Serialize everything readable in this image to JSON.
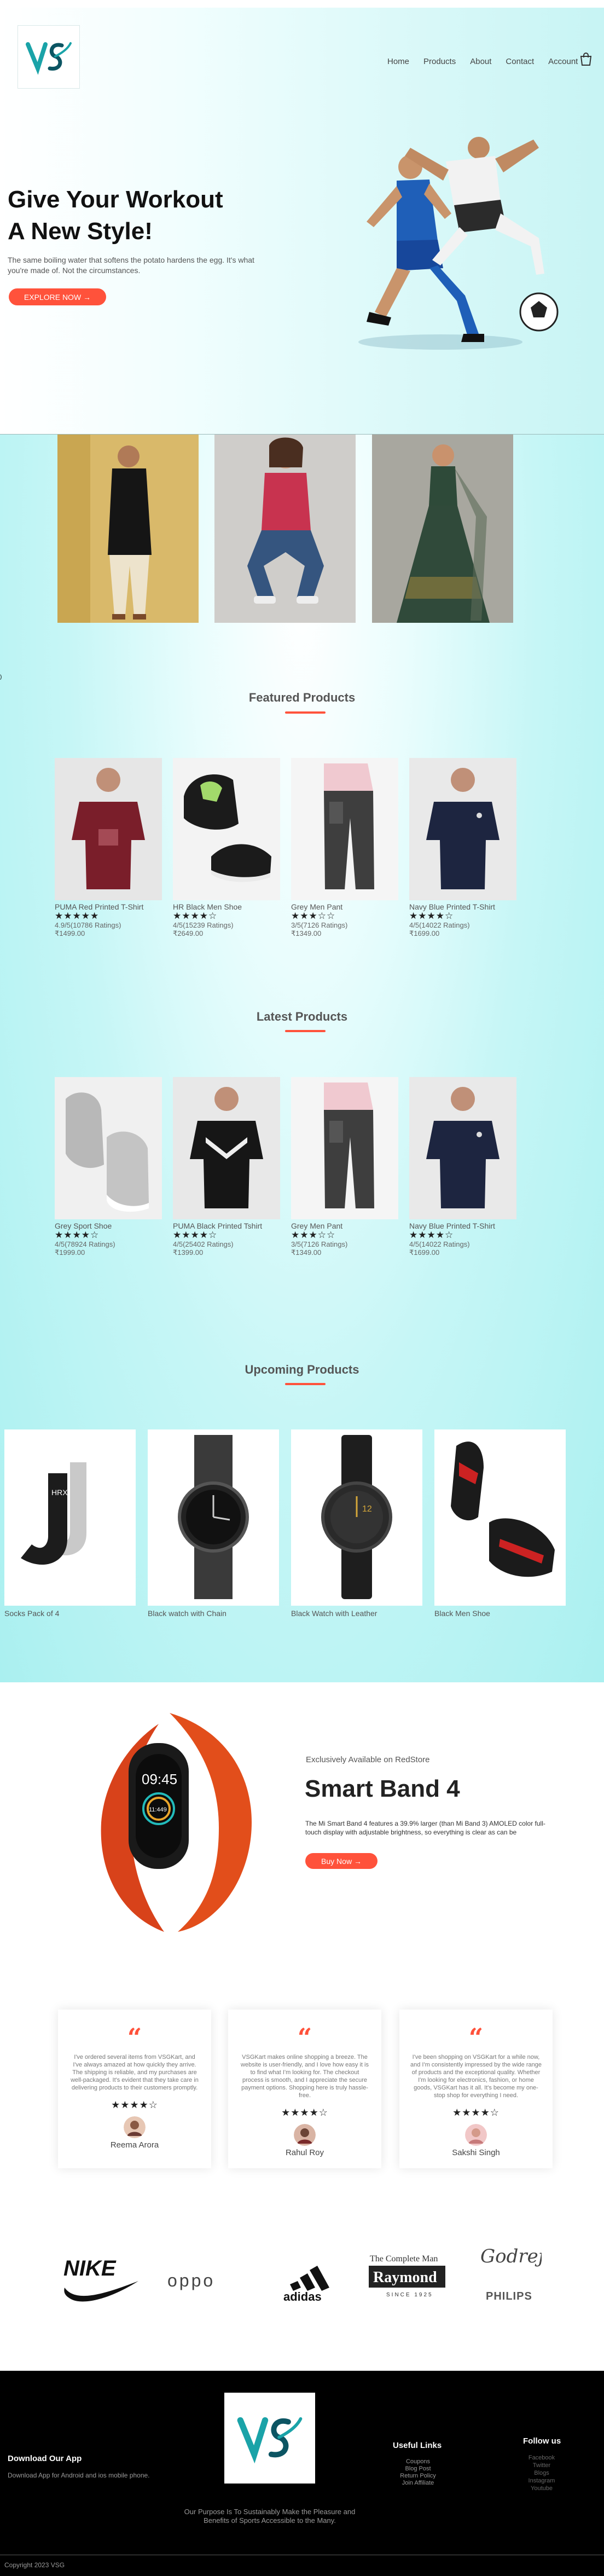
{
  "brand": {
    "logo_text": "VS"
  },
  "nav": {
    "items": [
      "Home",
      "Products",
      "About",
      "Contact",
      "Account"
    ]
  },
  "hero": {
    "title_line1": "Give Your Workout",
    "title_line2": "A New Style!",
    "subtitle": "The same boiling water that softens the potato hardens the egg. It's what you're made of. Not the circumstances.",
    "cta": "EXPLORE NOW →"
  },
  "featured": {
    "title": "Featured Products",
    "products": [
      {
        "name": "PUMA Red Printed T-Shirt",
        "stars": "★★★★★",
        "rating": "4.9/5(10786 Ratings)",
        "price": "₹1499.00"
      },
      {
        "name": "HR Black Men Shoe",
        "stars": "★★★★☆",
        "rating": "4/5(15239 Ratings)",
        "price": "₹2649.00"
      },
      {
        "name": "Grey Men Pant",
        "stars": "★★★☆☆",
        "rating": "3/5(7126 Ratings)",
        "price": "₹1349.00"
      },
      {
        "name": "Navy Blue Printed T-Shirt",
        "stars": "★★★★☆",
        "rating": "4/5(14022 Ratings)",
        "price": "₹1699.00"
      }
    ]
  },
  "latest": {
    "title": "Latest Products",
    "products": [
      {
        "name": "Grey Sport Shoe",
        "stars": "★★★★☆",
        "rating": "4/5(78924 Ratings)",
        "price": "₹1999.00"
      },
      {
        "name": "PUMA Black Printed Tshirt",
        "stars": "★★★★☆",
        "rating": "4/5(25402 Ratings)",
        "price": "₹1399.00"
      },
      {
        "name": "Grey Men Pant",
        "stars": "★★★☆☆",
        "rating": "3/5(7126 Ratings)",
        "price": "₹1349.00"
      },
      {
        "name": "Navy Blue Printed T-Shirt",
        "stars": "★★★★☆",
        "rating": "4/5(14022 Ratings)",
        "price": "₹1699.00"
      }
    ]
  },
  "upcoming": {
    "title": "Upcoming Products",
    "products": [
      {
        "name": "Socks Pack of 4"
      },
      {
        "name": "Black watch with Chain"
      },
      {
        "name": "Black Watch with Leather"
      },
      {
        "name": "Black Men Shoe"
      }
    ]
  },
  "smartband": {
    "exclusive": "Exclusively Available on RedStore",
    "title": "Smart Band 4",
    "description": "The Mi Smart Band 4 features a 39.9% larger (than Mi Band 3) AMOLED color full-touch display with adjustable brightness, so everything is clear as can be",
    "cta": "Buy Now →",
    "screen_time": "09:45",
    "screen_steps": "11:449"
  },
  "testimonials": [
    {
      "text": "I've ordered several items from VSGKart, and I've always amazed at how quickly they arrive. The shipping is reliable, and my purchases are well-packaged. It's evident that they take care in delivering products to their customers promptly.",
      "stars": "★★★★☆",
      "name": "Reema Arora"
    },
    {
      "text": "VSGKart makes online shopping a breeze. The website is user-friendly, and I love how easy it is to find what I'm looking for. The checkout process is smooth, and I appreciate the secure payment options. Shopping here is truly hassle-free.",
      "stars": "★★★★☆",
      "name": "Rahul Roy"
    },
    {
      "text": "I've been shopping on VSGKart for a while now, and I'm consistently impressed by the wide range of products and the exceptional quality. Whether I'm looking for electronics, fashion, or home goods, VSGKart has it all. It's become my one-stop shop for everything I need.",
      "stars": "★★★★☆",
      "name": "Sakshi Singh"
    }
  ],
  "brands": {
    "nike": "NIKE",
    "oppo": "oppo",
    "adidas": "adidas",
    "raymond_top": "The Complete Man",
    "raymond": "Raymond",
    "raymond_since": "SINCE 1925",
    "godrej": "Godrej",
    "philips": "PHILIPS"
  },
  "footer": {
    "download_title": "Download Our App",
    "download_text": "Download App for Android and ios mobile phone.",
    "purpose": "Our Purpose Is To Sustainably Make the Pleasure and Benefits of Sports Accessible to the Many.",
    "links_title": "Useful Links",
    "links": [
      "Coupons",
      "Blog Post",
      "Return Policy",
      "Join Affiliate"
    ],
    "follow_title": "Follow us",
    "follow": [
      "Facebook",
      "Twitter",
      "Blogs",
      "Instagram",
      "Youtube"
    ],
    "copyright": "Copyright 2023 VSG"
  },
  "colors": {
    "accent": "#ff523b",
    "aqua": "#aaf0f0",
    "footer_bg": "#000000"
  },
  "icons": {
    "cart": "shopping-bag-icon"
  }
}
